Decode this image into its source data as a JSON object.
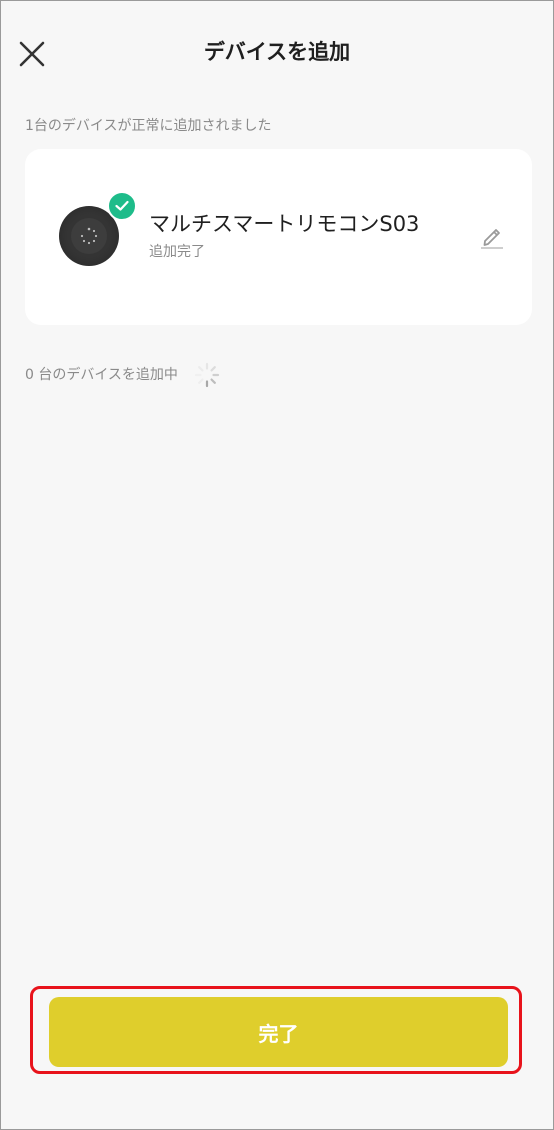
{
  "header": {
    "title": "デバイスを追加",
    "close_icon": "close-icon"
  },
  "summary": {
    "success_text": "1台のデバイスが正常に追加されました"
  },
  "device": {
    "name": "マルチスマートリモコンS03",
    "status": "追加完了",
    "badge_icon": "check-icon",
    "edit_icon": "pencil-icon"
  },
  "adding": {
    "text": "0 台のデバイスを追加中",
    "spinner_icon": "spinner-icon"
  },
  "footer": {
    "done_label": "完了"
  },
  "colors": {
    "background": "#f7f7f7",
    "card": "#ffffff",
    "success_badge": "#1ebc8a",
    "done_button": "#dfce2c",
    "highlight": "#e8131b",
    "text_primary": "#1f1f1f",
    "text_secondary": "#8a8a8a"
  }
}
